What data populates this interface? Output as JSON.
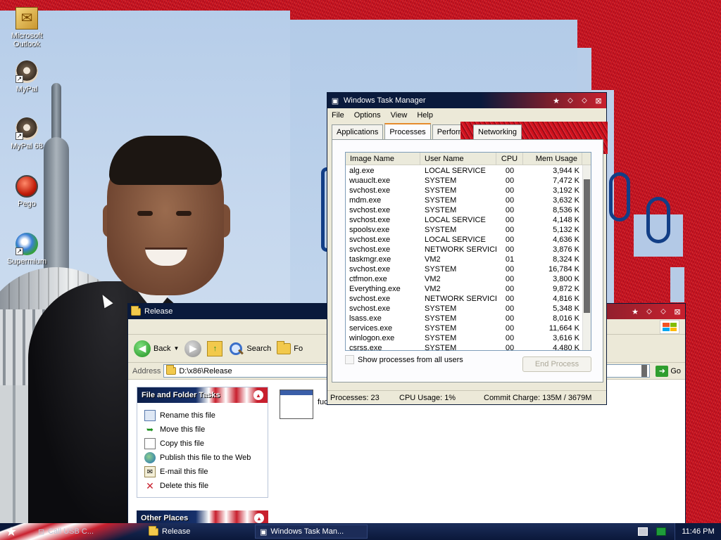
{
  "desktop": {
    "icons": [
      {
        "label": "Microsoft Outlook",
        "icon": "outlook-icon"
      },
      {
        "label": "MyPal",
        "icon": "raccoon-icon"
      },
      {
        "label": "MyPal 68",
        "icon": "raccoon-icon"
      },
      {
        "label": "Pego",
        "icon": "pego-icon"
      },
      {
        "label": "Supermium",
        "icon": "supermium-icon"
      }
    ]
  },
  "explorer": {
    "title": "Release",
    "toolbar": {
      "back": "Back",
      "search": "Search",
      "folders": "Fo"
    },
    "address": {
      "label": "Address",
      "path": "D:\\x86\\Release",
      "go": "Go"
    },
    "file_tasks": {
      "title": "File and Folder Tasks",
      "items": [
        {
          "label": "Rename this file",
          "icon": "rename-icon"
        },
        {
          "label": "Move this file",
          "icon": "move-icon"
        },
        {
          "label": "Copy this file",
          "icon": "copy-icon"
        },
        {
          "label": "Publish this file to the Web",
          "icon": "globe-icon"
        },
        {
          "label": "E-mail this file",
          "icon": "email-icon"
        },
        {
          "label": "Delete this file",
          "icon": "delete-icon"
        }
      ]
    },
    "other_places": {
      "title": "Other Places"
    },
    "file": {
      "name": "fuc"
    }
  },
  "taskmgr": {
    "title": "Windows Task Manager",
    "menu": [
      "File",
      "Options",
      "View",
      "Help"
    ],
    "tabs": [
      "Applications",
      "Processes",
      "Performan",
      "Networking"
    ],
    "active_tab": "Processes",
    "columns": [
      "Image Name",
      "User Name",
      "CPU",
      "Mem Usage"
    ],
    "rows": [
      [
        "alg.exe",
        "LOCAL SERVICE",
        "00",
        "3,944 K"
      ],
      [
        "wuauclt.exe",
        "SYSTEM",
        "00",
        "7,472 K"
      ],
      [
        "svchost.exe",
        "SYSTEM",
        "00",
        "3,192 K"
      ],
      [
        "mdm.exe",
        "SYSTEM",
        "00",
        "3,632 K"
      ],
      [
        "svchost.exe",
        "SYSTEM",
        "00",
        "8,536 K"
      ],
      [
        "svchost.exe",
        "LOCAL SERVICE",
        "00",
        "4,148 K"
      ],
      [
        "spoolsv.exe",
        "SYSTEM",
        "00",
        "5,132 K"
      ],
      [
        "svchost.exe",
        "LOCAL SERVICE",
        "00",
        "4,636 K"
      ],
      [
        "svchost.exe",
        "NETWORK SERVICE",
        "00",
        "3,876 K"
      ],
      [
        "taskmgr.exe",
        "VM2",
        "01",
        "8,324 K"
      ],
      [
        "svchost.exe",
        "SYSTEM",
        "00",
        "16,784 K"
      ],
      [
        "ctfmon.exe",
        "VM2",
        "00",
        "3,800 K"
      ],
      [
        "Everything.exe",
        "VM2",
        "00",
        "9,872 K"
      ],
      [
        "svchost.exe",
        "NETWORK SERVICE",
        "00",
        "4,816 K"
      ],
      [
        "svchost.exe",
        "SYSTEM",
        "00",
        "5,348 K"
      ],
      [
        "lsass.exe",
        "SYSTEM",
        "00",
        "8,016 K"
      ],
      [
        "services.exe",
        "SYSTEM",
        "00",
        "11,664 K"
      ],
      [
        "winlogon.exe",
        "SYSTEM",
        "00",
        "3,616 K"
      ],
      [
        "csrss.exe",
        "SYSTEM",
        "00",
        "4,480 K"
      ]
    ],
    "show_all_label": "Show processes from all users",
    "end_process_label": "End Process",
    "status": {
      "processes": "Processes: 23",
      "cpu": "CPU Usage: 1%",
      "commit": "Commit Charge: 135M / 3679M"
    }
  },
  "taskbar": {
    "tasks": [
      "Call USB C...",
      "Release",
      "Windows Task Man..."
    ],
    "clock": "11:46 PM"
  }
}
